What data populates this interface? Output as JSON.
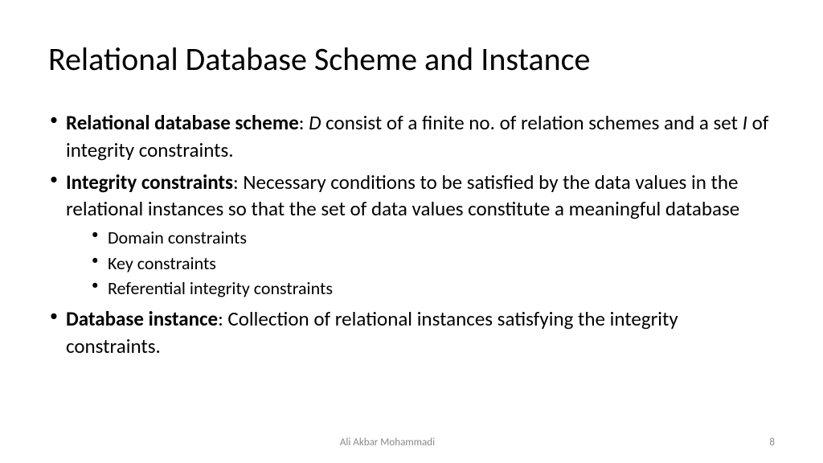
{
  "title": "Relational Database Scheme and Instance",
  "bullets": {
    "b1_bold": "Relational database scheme",
    "b1_sep": ": ",
    "b1_var1": "D",
    "b1_text1": " consist of a finite no. of relation schemes and a set ",
    "b1_var2": "I",
    "b1_text2": " of integrity constraints.",
    "b2_bold": "Integrity constraints",
    "b2_text": ": Necessary conditions to be satisfied by the data values in the relational instances so that the set of data values constitute a meaningful database",
    "b2_sub1": "Domain constraints",
    "b2_sub2": "Key constraints",
    "b2_sub3": "Referential integrity constraints",
    "b3_bold": "Database instance",
    "b3_text": ": Collection of relational instances satisfying the integrity constraints."
  },
  "footer": {
    "author": "Ali Akbar Mohammadi",
    "page": "8"
  }
}
